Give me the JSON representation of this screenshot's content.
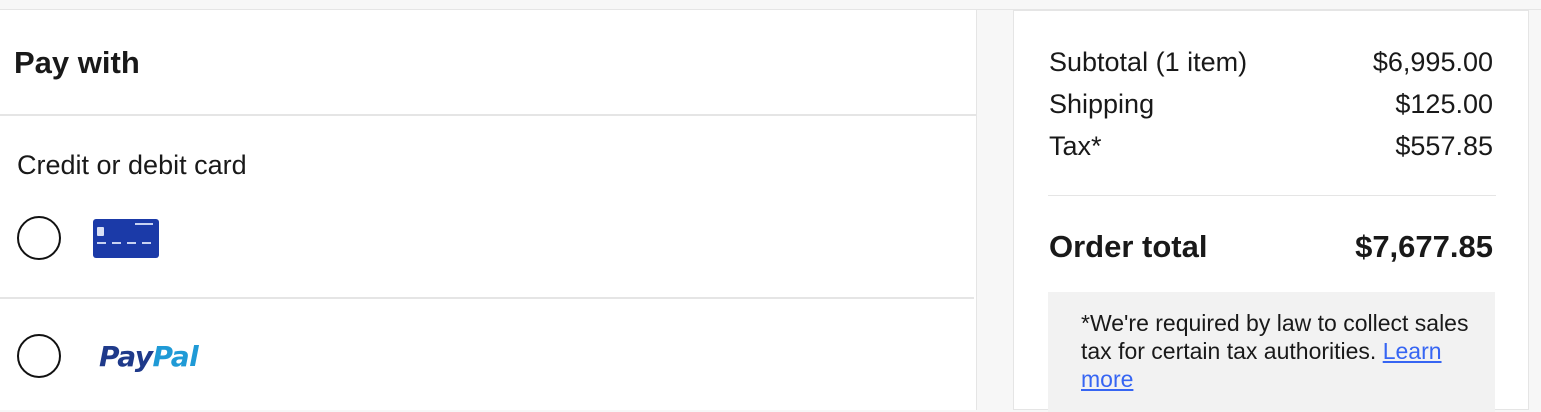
{
  "pay_with": {
    "title": "Pay with",
    "credit_card_label": "Credit or debit card",
    "options": [
      {
        "id": "card",
        "icon": "credit-card-icon",
        "selected": false
      },
      {
        "id": "paypal",
        "logo_part1": "Pay",
        "logo_part2": "Pal",
        "selected": false
      }
    ]
  },
  "summary": {
    "subtotal_label": "Subtotal (1 item)",
    "subtotal_value": "$6,995.00",
    "shipping_label": "Shipping",
    "shipping_value": "$125.00",
    "tax_label": "Tax*",
    "tax_value": "$557.85",
    "total_label": "Order total",
    "total_value": "$7,677.85",
    "tax_note": "*We're required by law to collect sales tax for certain tax authorities.",
    "learn_more": "Learn more"
  },
  "colors": {
    "card_blue": "#1b3aa8",
    "paypal_dark": "#1f3a8a",
    "paypal_light": "#1f9ad6",
    "link": "#3665f3"
  }
}
